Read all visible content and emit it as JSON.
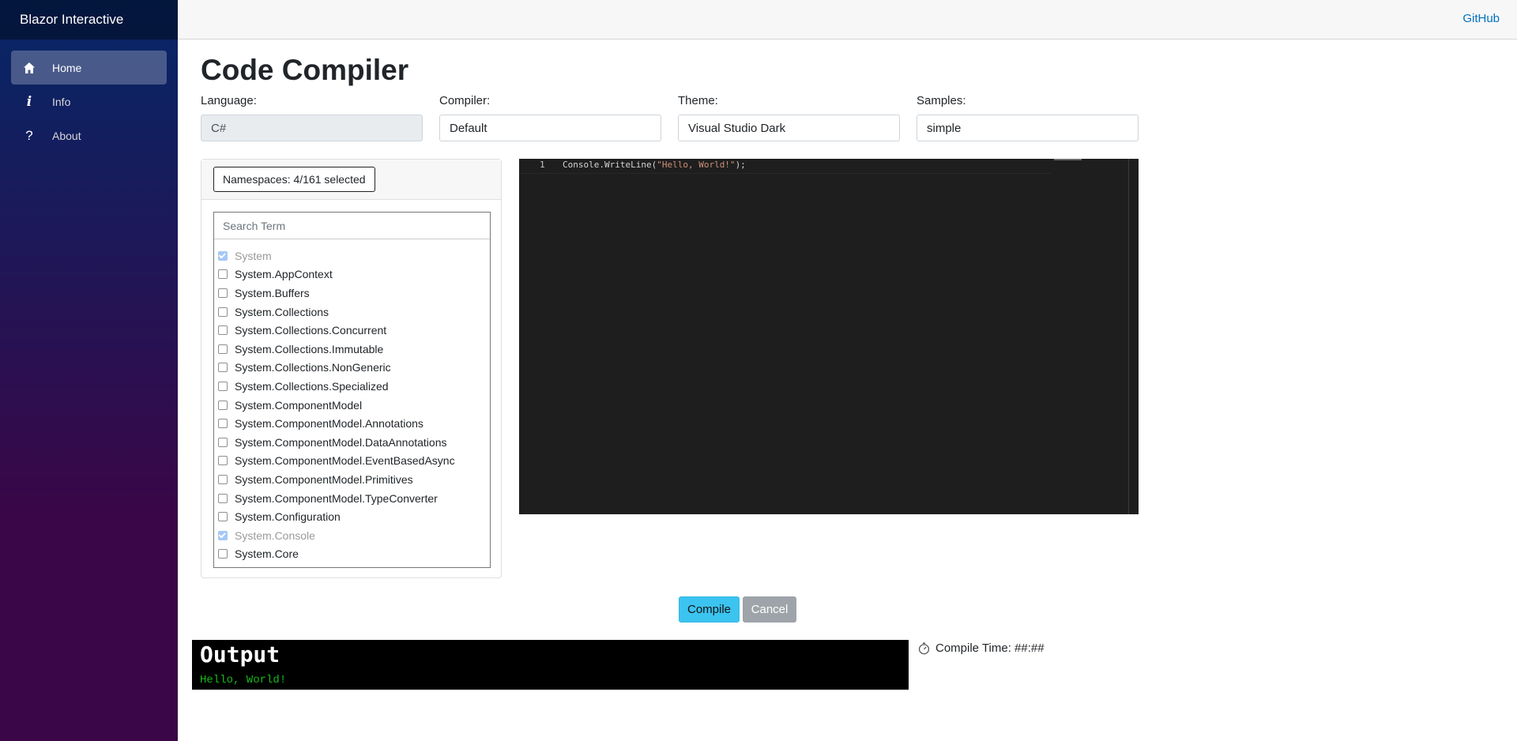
{
  "app": {
    "brand": "Blazor Interactive",
    "github_label": "GitHub"
  },
  "nav": {
    "items": [
      {
        "label": "Home",
        "icon": "home-icon",
        "active": true
      },
      {
        "label": "Info",
        "icon": "info-icon",
        "active": false
      },
      {
        "label": "About",
        "icon": "question-icon",
        "active": false
      }
    ]
  },
  "page": {
    "title": "Code Compiler"
  },
  "settings": {
    "language": {
      "label": "Language:",
      "value": "C#"
    },
    "compiler": {
      "label": "Compiler:",
      "value": "Default"
    },
    "theme": {
      "label": "Theme:",
      "value": "Visual Studio Dark"
    },
    "samples": {
      "label": "Samples:",
      "value": "simple"
    }
  },
  "namespaces": {
    "button_label": "Namespaces: 4/161 selected",
    "search_placeholder": "Search Term",
    "items": [
      {
        "name": "System",
        "checked": true
      },
      {
        "name": "System.AppContext",
        "checked": false
      },
      {
        "name": "System.Buffers",
        "checked": false
      },
      {
        "name": "System.Collections",
        "checked": false
      },
      {
        "name": "System.Collections.Concurrent",
        "checked": false
      },
      {
        "name": "System.Collections.Immutable",
        "checked": false
      },
      {
        "name": "System.Collections.NonGeneric",
        "checked": false
      },
      {
        "name": "System.Collections.Specialized",
        "checked": false
      },
      {
        "name": "System.ComponentModel",
        "checked": false
      },
      {
        "name": "System.ComponentModel.Annotations",
        "checked": false
      },
      {
        "name": "System.ComponentModel.DataAnnotations",
        "checked": false
      },
      {
        "name": "System.ComponentModel.EventBasedAsync",
        "checked": false
      },
      {
        "name": "System.ComponentModel.Primitives",
        "checked": false
      },
      {
        "name": "System.ComponentModel.TypeConverter",
        "checked": false
      },
      {
        "name": "System.Configuration",
        "checked": false
      },
      {
        "name": "System.Console",
        "checked": true
      },
      {
        "name": "System.Core",
        "checked": false
      }
    ]
  },
  "editor": {
    "line_number": "1",
    "code_prefix": "Console.WriteLine(",
    "code_string": "\"Hello, World!\"",
    "code_suffix": ");",
    "background": "#1e1e1e",
    "string_color": "#ce9178"
  },
  "actions": {
    "compile_label": "Compile",
    "cancel_label": "Cancel"
  },
  "output": {
    "title": "Output",
    "text": "Hello, World!",
    "text_color": "#18b81a"
  },
  "compile_time": {
    "label": "Compile Time: ##:##",
    "icon": "stopwatch-icon"
  }
}
